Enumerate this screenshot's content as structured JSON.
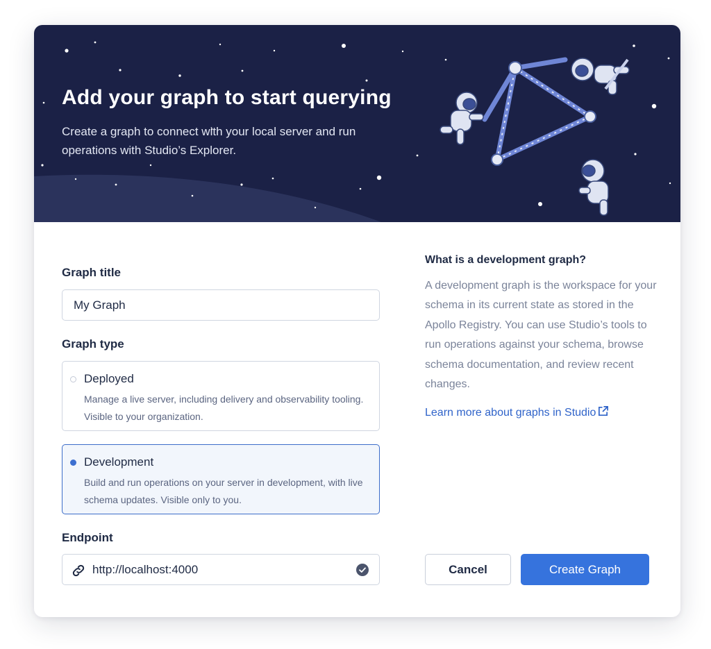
{
  "banner": {
    "title": "Add your graph to start querying",
    "subtitle": "Create a graph to connect with your local server and run operations with Studio’s Explorer."
  },
  "form": {
    "title_label": "Graph title",
    "title_value": "My Graph",
    "type_label": "Graph type",
    "options": [
      {
        "title": "Deployed",
        "description": "Manage a live server, including delivery and observability tooling. Visible to your organization.",
        "selected": false
      },
      {
        "title": "Development",
        "description": "Build and run operations on your server in development, with live schema updates. Visible only to you.",
        "selected": true
      }
    ],
    "endpoint_label": "Endpoint",
    "endpoint_value": "http://localhost:4000"
  },
  "sidebar": {
    "heading": "What is a development graph?",
    "body": "A development graph is the workspace for your schema in its current state as stored in the Apollo Registry. You can use Studio’s tools to run operations against your schema, browse schema documentation, and review recent changes.",
    "link_label": "Learn more about graphs in Studio"
  },
  "actions": {
    "cancel_label": "Cancel",
    "create_label": "Create Graph"
  },
  "colors": {
    "banner_bg": "#1b2146",
    "accent": "#3673dd",
    "link": "#2f63c9",
    "selected_bg": "#f2f6fc"
  },
  "icons": {
    "link": "link-icon",
    "check": "check-circle-icon",
    "external": "external-link-icon"
  }
}
